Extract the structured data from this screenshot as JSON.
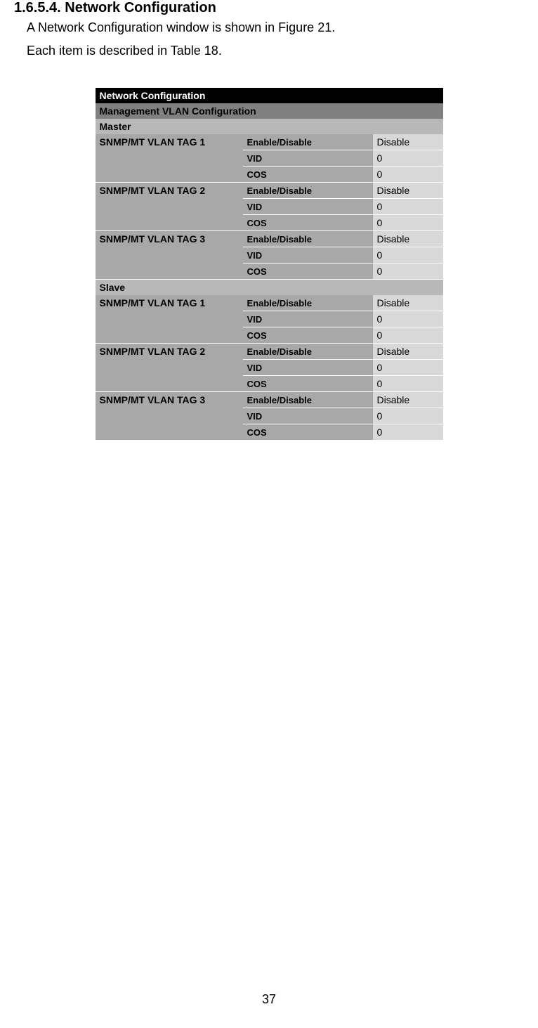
{
  "heading": "1.6.5.4. Network Configuration",
  "para1": "A Network Configuration window is shown in Figure 21.",
  "para2": "Each item is described in Table 18.",
  "table": {
    "title": "Network Configuration",
    "subtitle": "Management VLAN Configuration",
    "sections": [
      {
        "name": "Master",
        "tags": [
          {
            "label": "SNMP/MT VLAN TAG 1",
            "rows": [
              {
                "param": "Enable/Disable",
                "value": "Disable"
              },
              {
                "param": "VID",
                "value": "0"
              },
              {
                "param": "COS",
                "value": "0"
              }
            ]
          },
          {
            "label": "SNMP/MT VLAN TAG 2",
            "rows": [
              {
                "param": "Enable/Disable",
                "value": "Disable"
              },
              {
                "param": "VID",
                "value": "0"
              },
              {
                "param": "COS",
                "value": "0"
              }
            ]
          },
          {
            "label": "SNMP/MT VLAN TAG 3",
            "rows": [
              {
                "param": "Enable/Disable",
                "value": "Disable"
              },
              {
                "param": "VID",
                "value": "0"
              },
              {
                "param": "COS",
                "value": "0"
              }
            ]
          }
        ]
      },
      {
        "name": "Slave",
        "tags": [
          {
            "label": "SNMP/MT VLAN TAG 1",
            "rows": [
              {
                "param": "Enable/Disable",
                "value": "Disable"
              },
              {
                "param": "VID",
                "value": "0"
              },
              {
                "param": "COS",
                "value": "0"
              }
            ]
          },
          {
            "label": "SNMP/MT VLAN TAG 2",
            "rows": [
              {
                "param": "Enable/Disable",
                "value": "Disable"
              },
              {
                "param": "VID",
                "value": "0"
              },
              {
                "param": "COS",
                "value": "0"
              }
            ]
          },
          {
            "label": "SNMP/MT VLAN TAG 3",
            "rows": [
              {
                "param": "Enable/Disable",
                "value": "Disable"
              },
              {
                "param": "VID",
                "value": "0"
              },
              {
                "param": "COS",
                "value": "0"
              }
            ]
          }
        ]
      }
    ]
  },
  "page_number": "37"
}
